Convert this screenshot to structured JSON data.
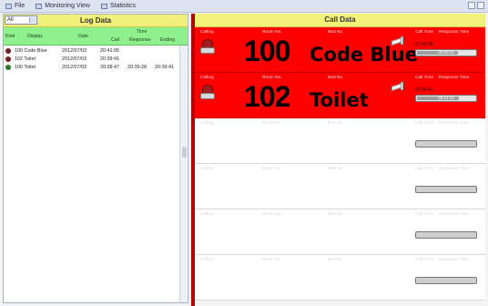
{
  "menu": {
    "items": [
      {
        "label": "File",
        "icon": "file-icon"
      },
      {
        "label": "Monitoring View",
        "icon": "monitor-icon"
      },
      {
        "label": "Statistics",
        "icon": "chart-icon"
      }
    ]
  },
  "log": {
    "title": "Log Data",
    "filter_value": "All",
    "columns": {
      "kind": "Kind",
      "display": "Display",
      "date": "Date",
      "time_group": "Time",
      "call": "Call",
      "response": "Response",
      "ending": "Ending"
    },
    "rows": [
      {
        "icon": "bell-icon",
        "icon_color": "#7a1c1c",
        "display": "100 Code Blue",
        "date": "2012/07/03",
        "call": "20:41:05",
        "response": "",
        "ending": ""
      },
      {
        "icon": "bell-icon",
        "icon_color": "#7a1c1c",
        "display": "102 Toilet",
        "date": "2012/07/03",
        "call": "20:39:41",
        "response": "",
        "ending": ""
      },
      {
        "icon": "bell-icon",
        "icon_color": "#2a7a2a",
        "display": "100 Toilet",
        "date": "2012/07/03",
        "call": "20:38:47",
        "response": "20:39:28",
        "ending": "20:39:41"
      }
    ]
  },
  "calls": {
    "title": "Call Data",
    "headers": {
      "calling": "Calling",
      "room": "Room No.",
      "bed": "Bed No.",
      "call_time": "Call Time",
      "response_time": "Response Time"
    },
    "cards": [
      {
        "active": true,
        "room": "100",
        "bed": "Code Blue",
        "call_time": "20:41:05",
        "response_progress": 0.7,
        "response_text": "00:00:10"
      },
      {
        "active": true,
        "room": "102",
        "bed": "Toilet",
        "call_time": "20:39:41",
        "response_progress": 0.72,
        "response_text": "00:01:34"
      },
      {
        "active": false,
        "room": "",
        "bed": "",
        "call_time": "",
        "response_progress": 0.0,
        "response_text": ""
      },
      {
        "active": false,
        "room": "",
        "bed": "",
        "call_time": "",
        "response_progress": 0.0,
        "response_text": ""
      },
      {
        "active": false,
        "room": "",
        "bed": "",
        "call_time": "",
        "response_progress": 0.0,
        "response_text": ""
      },
      {
        "active": false,
        "room": "",
        "bed": "",
        "call_time": "",
        "response_progress": 0.0,
        "response_text": ""
      }
    ]
  }
}
